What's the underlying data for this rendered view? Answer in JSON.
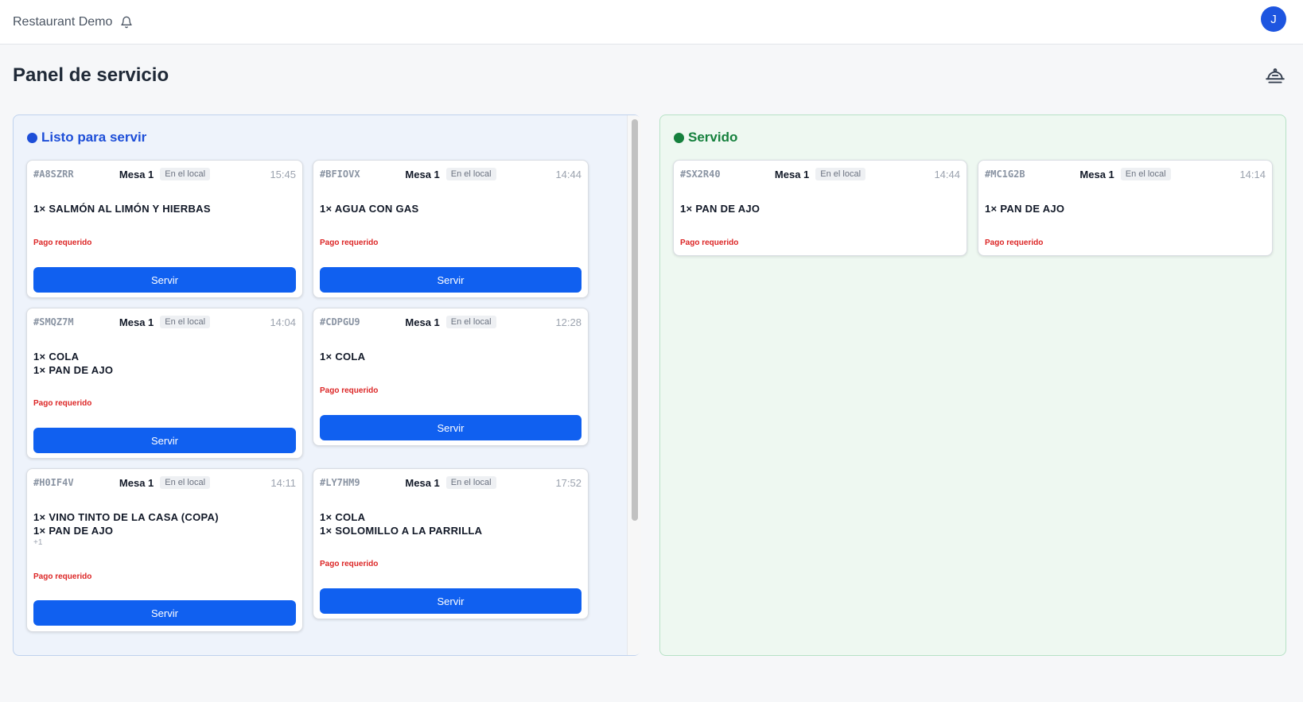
{
  "header": {
    "app_title": "Restaurant Demo",
    "avatar_initial": "J"
  },
  "page": {
    "title": "Panel de servicio"
  },
  "columns": {
    "ready": {
      "title": "Listo para servir",
      "color": "#1d4ed8",
      "orders": [
        {
          "id": "#A8SZRR",
          "table": "Mesa 1",
          "badge": "En el local",
          "time": "15:45",
          "items": [
            "1× SALMÓN AL LIMÓN Y HIERBAS"
          ],
          "more": "",
          "payment": "Pago requerido",
          "button": "Servir"
        },
        {
          "id": "#BFIOVX",
          "table": "Mesa 1",
          "badge": "En el local",
          "time": "14:44",
          "items": [
            "1× AGUA CON GAS"
          ],
          "more": "",
          "payment": "Pago requerido",
          "button": "Servir"
        },
        {
          "id": "#SMQZ7M",
          "table": "Mesa 1",
          "badge": "En el local",
          "time": "14:04",
          "items": [
            "1× COLA",
            "1× PAN DE AJO"
          ],
          "more": "",
          "payment": "Pago requerido",
          "button": "Servir"
        },
        {
          "id": "#CDPGU9",
          "table": "Mesa 1",
          "badge": "En el local",
          "time": "12:28",
          "items": [
            "1× COLA"
          ],
          "more": "",
          "payment": "Pago requerido",
          "button": "Servir"
        },
        {
          "id": "#H0IF4V",
          "table": "Mesa 1",
          "badge": "En el local",
          "time": "14:11",
          "items": [
            "1× VINO TINTO DE LA CASA (COPA)",
            "1× PAN DE AJO"
          ],
          "more": "+1",
          "payment": "Pago requerido",
          "button": "Servir"
        },
        {
          "id": "#LY7HM9",
          "table": "Mesa 1",
          "badge": "En el local",
          "time": "17:52",
          "items": [
            "1× COLA",
            "1× SOLOMILLO A LA PARRILLA"
          ],
          "more": "",
          "payment": "Pago requerido",
          "button": "Servir"
        }
      ]
    },
    "served": {
      "title": "Servido",
      "color": "#15803d",
      "orders": [
        {
          "id": "#SX2R40",
          "table": "Mesa 1",
          "badge": "En el local",
          "time": "14:44",
          "items": [
            "1× PAN DE AJO"
          ],
          "payment": "Pago requerido"
        },
        {
          "id": "#MC1G2B",
          "table": "Mesa 1",
          "badge": "En el local",
          "time": "14:14",
          "items": [
            "1× PAN DE AJO"
          ],
          "payment": "Pago requerido"
        }
      ]
    }
  }
}
